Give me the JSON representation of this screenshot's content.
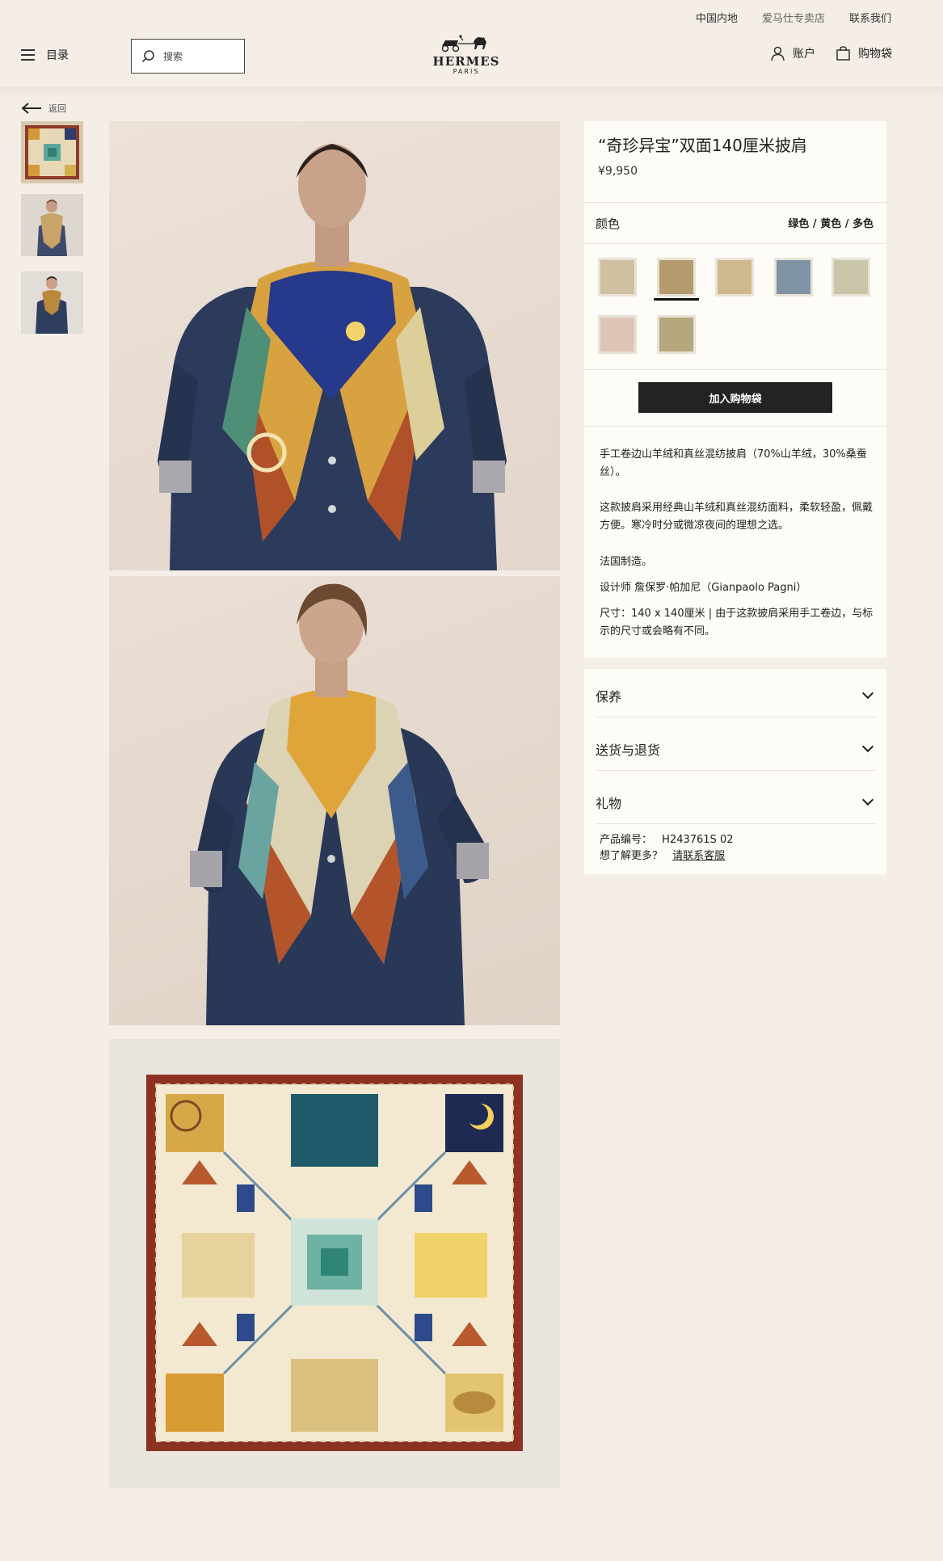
{
  "util_bar": [
    "中国内地",
    "爱马仕专卖店",
    "联系我们"
  ],
  "header": {
    "menu_label": "目录",
    "search_placeholder": "搜索",
    "brand": "HERMES",
    "brand_city": "PARIS",
    "account_label": "账户",
    "bag_label": "购物袋"
  },
  "back_label": "返回",
  "product": {
    "title": "“奇珍异宝”双面140厘米披肩",
    "price": "¥9,950",
    "color_label": "颜色",
    "color_value": "绿色 / 黄色 / 多色",
    "swatch_colors": [
      "#cfc0a2",
      "#b39b6d",
      "#d1b98e",
      "#8093a4",
      "#c8c5a8",
      "#dfc4b8",
      "#b6a87d"
    ],
    "selected_swatch": 2,
    "add_to_bag": "加入购物袋",
    "description": [
      "手工卷边山羊绒和真丝混纺披肩（70%山羊绒，30%桑蚕丝）。",
      "这款披肩采用经典山羊绒和真丝混纺面料，柔软轻盈，佩戴方便。寒冷时分或微凉夜间的理想之选。",
      "法国制造。",
      "设计师 詹保罗·帕加尼（Gianpaolo Pagni）",
      "尺寸：140 x 140厘米 | 由于这款披肩采用手工卷边，与标示的尺寸或会略有不同。"
    ]
  },
  "accordion": [
    "保养",
    "送货与退货",
    "礼物"
  ],
  "meta": {
    "sku_label": "产品编号：",
    "sku_value": "H243761S 02",
    "help_label": "想了解更多？",
    "help_link": "请联系客服"
  },
  "icons": {
    "menu": "hamburger-icon",
    "search": "search-icon",
    "account": "user-icon",
    "bag": "bag-icon",
    "back": "arrow-left-icon",
    "expand": "chevron-down-icon"
  }
}
